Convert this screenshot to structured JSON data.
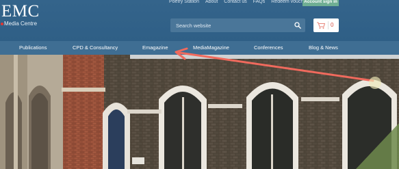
{
  "header": {
    "logo_main": "EMC",
    "logo_sub": "Media Centre",
    "top_links": [
      "Poetry Station",
      "About",
      "Contact us",
      "FAQs",
      "Redeem voucher"
    ],
    "signin_label": "Account sign in"
  },
  "search": {
    "placeholder": "Search website"
  },
  "cart": {
    "count": "0"
  },
  "nav": {
    "items": [
      "Publications",
      "CPD & Consultancy",
      "Emagazine",
      "MediaMagazine",
      "Conferences",
      "Blog & News"
    ]
  },
  "colors": {
    "header_bg": "#2f5f86",
    "nav_bg": "#3f6e93",
    "signin_bg": "#6fae93",
    "arrow": "#f06a5d"
  },
  "icons": [
    "search-icon",
    "cart-icon",
    "annotation-arrow"
  ]
}
